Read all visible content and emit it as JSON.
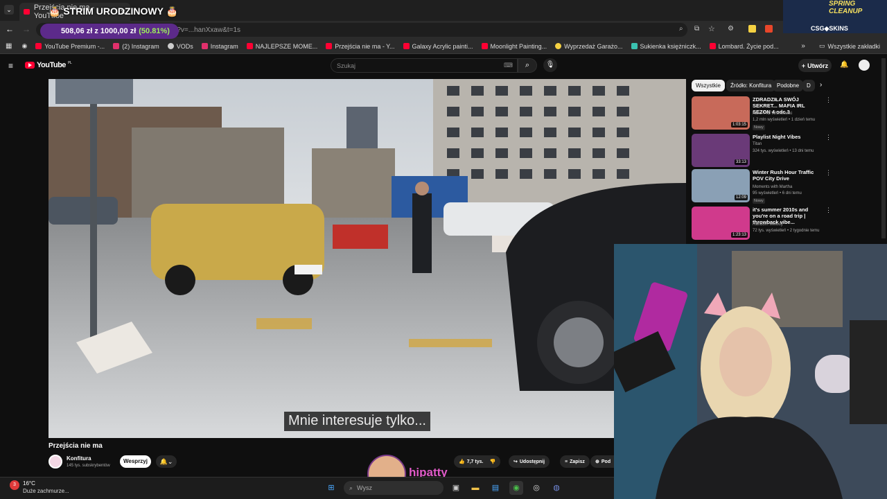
{
  "browser": {
    "tab_title": "Przejścia nie ma - YouTube",
    "url_fragment": "...s?v=...hanXxaw&t=1s",
    "bookmarks": [
      {
        "label": "YouTube Premium -...",
        "color": "#ff0033"
      },
      {
        "label": "(2) Instagram",
        "color": "#e1306c"
      },
      {
        "label": "VODs",
        "color": "#cccccc"
      },
      {
        "label": "Instagram",
        "color": "#e1306c"
      },
      {
        "label": "NAJLEPSZE MOME...",
        "color": "#ff0033"
      },
      {
        "label": "Przejścia nie ma - Y...",
        "color": "#ff0033"
      },
      {
        "label": "Galaxy Acrylic painti...",
        "color": "#ff0033"
      },
      {
        "label": "Moonlight Painting...",
        "color": "#ff0033"
      },
      {
        "label": "Wyprzedaż Garażo...",
        "color": "#f5d142"
      },
      {
        "label": "Sukienka księżniczk...",
        "color": "#3ac2b0"
      },
      {
        "label": "Lombard. Życie pod...",
        "color": "#ff0033"
      }
    ],
    "all_bookmarks": "Wszystkie zakładki"
  },
  "overlay": {
    "birthday": "🎂 STRIM URODZINOWY 🎂",
    "goal_amount": "508,06 zł z 1000,00 zł",
    "goal_pct": "(50.81%)",
    "goal_fraction": 0.5081,
    "sponsor_title": "SPRING CLEANUP",
    "sponsor_name": "CSG◆SKINS",
    "streamer": "hipatty"
  },
  "youtube": {
    "logo": "YouTube",
    "logo_region": "PL",
    "search_placeholder": "Szukaj",
    "create_label": "Utwórz",
    "chips": [
      "Wszystkie",
      "Źródło: Konfitura",
      "Podobne",
      "D"
    ],
    "subtitle": "Mnie interesuje tylko...",
    "video_title": "Przejścia nie ma",
    "channel_name": "Konfitura",
    "channel_subs": "145 tys. subskrybentów",
    "support_label": "Wesprzyj",
    "likes": "7,7 tys.",
    "share": "Udostępnij",
    "save": "Zapisz",
    "more": "Pod",
    "recommendations": [
      {
        "title": "ZDRADZIŁA SWÓJ SEKRET... MAFIA IRL SEZON 4 odc.3",
        "channel": "Karol Friz Wiśniewski",
        "meta": "1,2 mln wyświetleń • 1 dzień temu",
        "badge": "Nowy",
        "duration": "1:03:15",
        "color": "#c86a5a"
      },
      {
        "title": "Playlist Night Vibes",
        "channel": "Titan",
        "meta": "324 tys. wyświetleń • 13 dni temu",
        "badge": "",
        "duration": "33:13",
        "color": "#6a3a78"
      },
      {
        "title": "Winter Rush Hour Traffic POV City Drive",
        "channel": "Moments with Martha",
        "meta": "95 wyświetleń • 6 dni temu",
        "badge": "Nowy",
        "duration": "12:09",
        "color": "#8aa0b5"
      },
      {
        "title": "it's summer 2010s and you're on a road trip | throwback vibe...",
        "channel": "Random Melody",
        "meta": "72 tys. wyświetleń • 2 tygodnie temu",
        "badge": "",
        "duration": "1:23:13",
        "color": "#d03a8c"
      }
    ]
  },
  "taskbar": {
    "temp": "16°C",
    "weather": "Duże zachmurze...",
    "notif": "3",
    "search": "Wysz"
  }
}
